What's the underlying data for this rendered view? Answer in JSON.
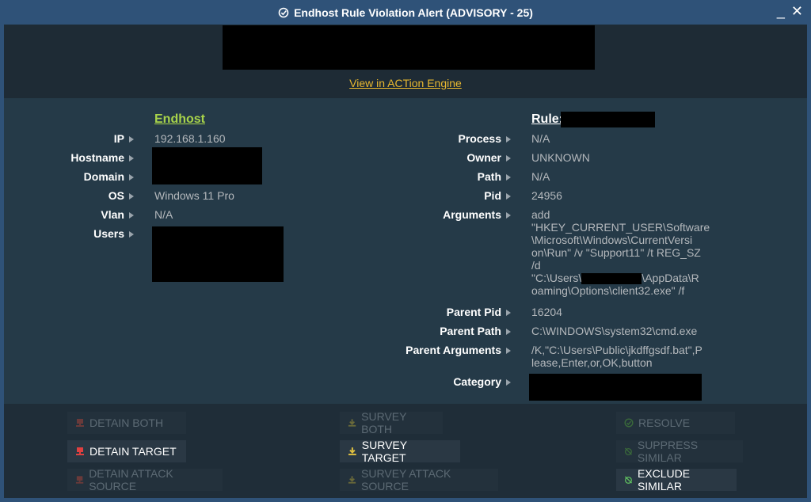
{
  "window": {
    "title": "Endhost Rule Violation Alert (ADVISORY - 25)",
    "minimize_label": "_",
    "close_label": "✕"
  },
  "header": {
    "engine_link": "View in ACTion Engine"
  },
  "endhost": {
    "title": "Endhost",
    "fields": {
      "ip_label": "IP",
      "ip_value": "192.168.1.160",
      "hostname_label": "Hostname",
      "domain_label": "Domain",
      "os_label": "OS",
      "os_value": "Windows 11 Pro",
      "vlan_label": "Vlan",
      "vlan_value": "N/A",
      "users_label": "Users"
    }
  },
  "rule": {
    "title": "Rule:",
    "fields": {
      "process_label": "Process",
      "process_value": "N/A",
      "owner_label": "Owner",
      "owner_value": "UNKNOWN",
      "path_label": "Path",
      "path_value": "N/A",
      "pid_label": "Pid",
      "pid_value": "24956",
      "arguments_label": "Arguments",
      "arguments_line1": "add",
      "arguments_line2": "\"HKEY_CURRENT_USER\\Software",
      "arguments_line3": "\\Microsoft\\Windows\\CurrentVersi",
      "arguments_line4": "on\\Run\" /v \"Support11\" /t REG_SZ",
      "arguments_line5": "/d",
      "arguments_line6a": "\"C:\\Users\\",
      "arguments_line6b": "\\AppData\\R",
      "arguments_line7": "oaming\\Options\\client32.exe\" /f",
      "parent_pid_label": "Parent Pid",
      "parent_pid_value": "16204",
      "parent_path_label": "Parent Path",
      "parent_path_value": "C:\\WINDOWS\\system32\\cmd.exe",
      "parent_args_label": "Parent Arguments",
      "parent_args_line1": "/K,\"C:\\Users\\Public\\jkdffgsdf.bat\",P",
      "parent_args_line2": "lease,Enter,or,OK,button",
      "category_label": "Category"
    }
  },
  "actions": {
    "detain_both": "DETAIN BOTH",
    "detain_target": "DETAIN TARGET",
    "detain_attack_source": "DETAIN ATTACK SOURCE",
    "survey_both": "SURVEY BOTH",
    "survey_target": "SURVEY TARGET",
    "survey_attack_source": "SURVEY ATTACK SOURCE",
    "resolve": "RESOLVE",
    "suppress_similar": "SUPPRESS SIMILAR",
    "exclude_similar": "EXCLUDE SIMILAR"
  },
  "colors": {
    "accent_link": "#e8b830",
    "endhost_title": "#a8d44a",
    "detain_icon": "#e04040",
    "survey_icon": "#e0c040",
    "resolve_icon": "#60c060"
  }
}
